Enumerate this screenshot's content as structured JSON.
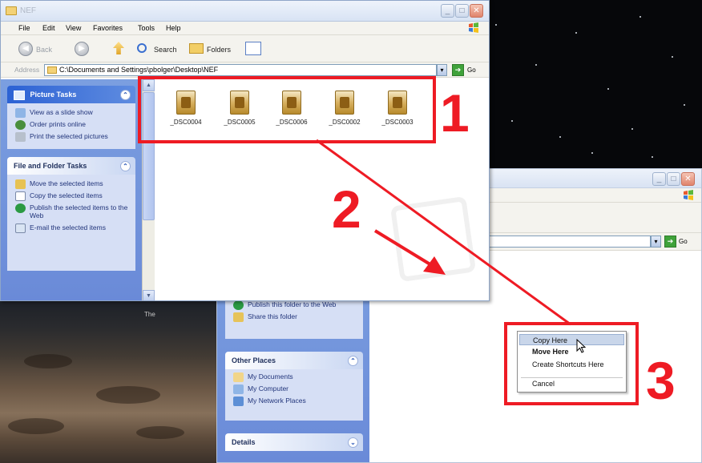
{
  "window1": {
    "title": "NEF",
    "menu": [
      "File",
      "Edit",
      "View",
      "Favorites",
      "Tools",
      "Help"
    ],
    "toolbar": {
      "back_label": "Back",
      "search_label": "Search",
      "folders_label": "Folders"
    },
    "address": {
      "label": "Address",
      "value": "C:\\Documents and Settings\\pbolger\\Desktop\\NEF",
      "go_label": "Go"
    },
    "picture_tasks": {
      "title": "Picture Tasks",
      "items": [
        "View as a slide show",
        "Order prints online",
        "Print the selected pictures"
      ]
    },
    "file_folder_tasks": {
      "title": "File and Folder Tasks",
      "items": [
        "Move the selected items",
        "Copy the selected items",
        "Publish the selected items to the Web",
        "E-mail the selected items"
      ]
    },
    "files": [
      "_DSC0004",
      "_DSC0005",
      "_DSC0006",
      "_DSC0002",
      "_DSC0003"
    ]
  },
  "window2": {
    "go_label": "Go",
    "tasks": [
      "Publish this folder to the Web",
      "Share this folder"
    ],
    "other_places": {
      "title": "Other Places",
      "items": [
        "My Documents",
        "My Computer",
        "My Network Places"
      ]
    },
    "details": {
      "title": "Details"
    }
  },
  "context_menu": {
    "items": [
      "Copy Here",
      "Move Here",
      "Create Shortcuts Here",
      "Cancel"
    ],
    "highlighted": "Copy Here",
    "default_item": "Move Here"
  },
  "desktop": {
    "label": "The"
  },
  "annotations": {
    "steps": [
      "1",
      "2",
      "3"
    ],
    "color": "#ee1b24"
  }
}
